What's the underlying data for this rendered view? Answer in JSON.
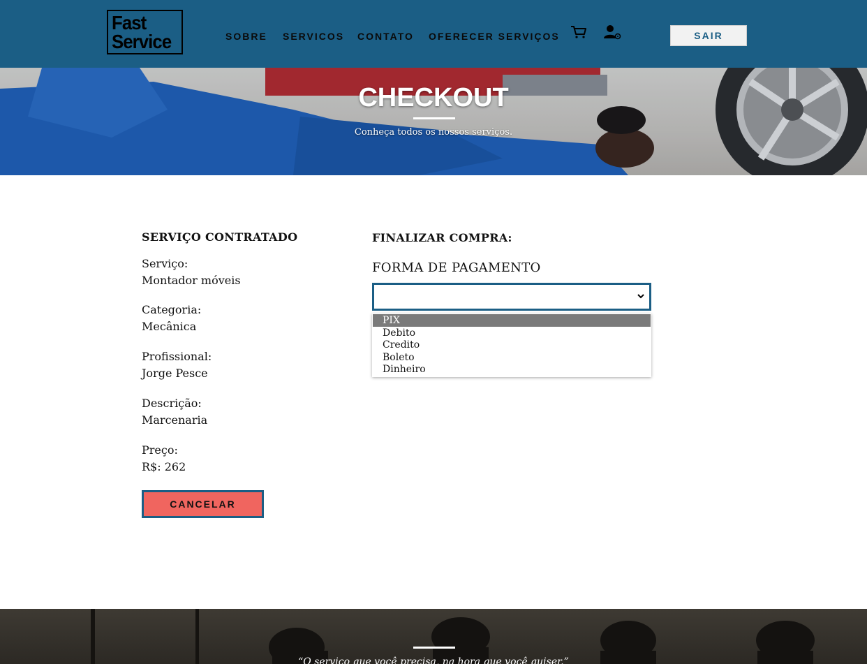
{
  "header": {
    "logo_line1": "Fast",
    "logo_line2": "Service",
    "nav": [
      {
        "label": "SOBRE"
      },
      {
        "label": "SERVICOS"
      },
      {
        "label": "CONTATO"
      },
      {
        "label": "OFERECER SERVIÇOS"
      }
    ],
    "cart_icon": "shopping-cart",
    "user_icon": "user-settings",
    "logout_label": "SAIR"
  },
  "hero": {
    "title": "CHECKOUT",
    "subtitle": "Conheça todos os nossos serviços."
  },
  "summary": {
    "title": "SERVIÇO CONTRATADO",
    "fields": [
      {
        "label": "Serviço:",
        "value": "Montador móveis"
      },
      {
        "label": "Categoria:",
        "value": "Mecânica"
      },
      {
        "label": "Profissional:",
        "value": "Jorge Pesce"
      },
      {
        "label": "Descrição:",
        "value": "Marcenaria"
      },
      {
        "label": "Preço:",
        "value": "R$: 262"
      }
    ],
    "cancel_label": "CANCELAR"
  },
  "checkout": {
    "title": "FINALIZAR COMPRA:",
    "payment_label": "FORMA DE PAGAMENTO",
    "selected_value": "",
    "options": [
      "PIX",
      "Debito",
      "Credito",
      "Boleto",
      "Dinheiro"
    ],
    "highlighted_option": "PIX"
  },
  "footer": {
    "quote": "“O serviço que você precisa, na hora que você quiser.”"
  },
  "colors": {
    "primary": "#1b5e85",
    "cancel": "#f0655f"
  }
}
